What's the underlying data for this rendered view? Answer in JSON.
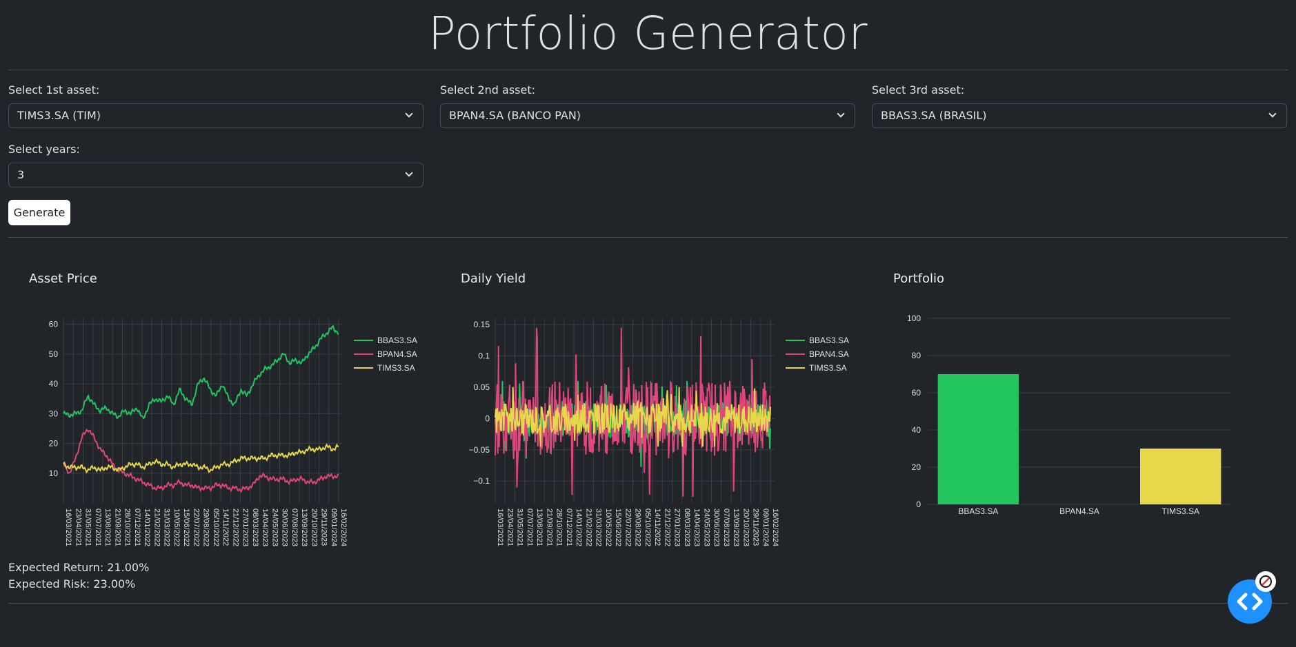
{
  "header": {
    "title": "Portfolio Generator"
  },
  "form": {
    "asset1": {
      "label": "Select 1st asset:",
      "value": "TIMS3.SA (TIM)"
    },
    "asset2": {
      "label": "Select 2nd asset:",
      "value": "BPAN4.SA (BANCO PAN)"
    },
    "asset3": {
      "label": "Select 3rd asset:",
      "value": "BBAS3.SA (BRASIL)"
    },
    "years": {
      "label": "Select years:",
      "value": "3"
    },
    "generate_label": "Generate"
  },
  "charts": {
    "price_title": "Asset Price",
    "yield_title": "Daily Yield",
    "portfolio_title": "Portfolio"
  },
  "results": {
    "expected_return": "Expected Return: 21.00%",
    "expected_risk": "Expected Risk: 23.00%"
  },
  "icons": {
    "fab": "code-icon",
    "badge": "block-icon"
  },
  "colors": {
    "BBAS3.SA": "#22c55e",
    "BPAN4.SA": "#e0457b",
    "TIMS3.SA": "#e6d84a",
    "fab": "#1e90ff"
  },
  "chart_data": [
    {
      "type": "line",
      "title": "Asset Price",
      "ylim": [
        0,
        62
      ],
      "yticks": [
        "10",
        "20",
        "30",
        "40",
        "50",
        "60"
      ],
      "ytick_values": [
        10,
        20,
        30,
        40,
        50,
        60
      ],
      "xticks": [
        "16/03/2021",
        "23/04/2021",
        "31/05/2021",
        "07/07/2021",
        "13/08/2021",
        "21/09/2021",
        "28/10/2021",
        "07/12/2021",
        "14/01/2022",
        "21/02/2022",
        "31/03/2022",
        "10/05/2022",
        "15/06/2022",
        "22/07/2022",
        "29/08/2022",
        "05/10/2022",
        "14/11/2022",
        "21/12/2022",
        "27/01/2023",
        "08/03/2023",
        "14/04/2023",
        "24/05/2023",
        "30/06/2023",
        "07/08/2023",
        "13/09/2023",
        "20/10/2023",
        "29/11/2023",
        "09/01/2024",
        "16/02/2024"
      ],
      "legend": [
        "BBAS3.SA",
        "BPAN4.SA",
        "TIMS3.SA"
      ],
      "series": [
        {
          "name": "BBAS3.SA",
          "values": [
            30,
            29.5,
            30,
            31,
            36,
            33,
            31,
            32,
            30,
            29,
            31,
            30,
            32,
            28,
            33,
            35,
            34,
            36,
            33,
            38,
            35,
            33,
            40,
            42,
            38,
            36,
            40,
            35,
            33,
            38,
            36,
            40,
            43,
            45,
            46,
            48,
            50,
            47,
            48,
            47,
            50,
            52,
            55,
            57,
            59,
            57
          ]
        },
        {
          "name": "BPAN4.SA",
          "values": [
            13,
            10,
            15,
            22,
            25,
            22,
            18,
            16,
            13,
            11,
            10,
            9,
            8,
            7,
            6,
            5,
            5,
            6,
            6,
            7,
            6,
            6,
            5,
            5,
            5,
            6,
            6,
            5,
            5,
            4.5,
            5,
            6,
            9,
            9,
            8,
            8,
            8,
            7,
            8,
            8,
            7,
            7,
            8,
            9,
            9,
            9
          ]
        },
        {
          "name": "TIMS3.SA",
          "values": [
            13,
            12,
            12,
            12,
            11,
            12,
            11,
            12,
            12,
            11,
            12,
            13,
            13,
            12,
            13,
            14,
            13,
            13,
            12,
            13,
            13,
            13,
            12,
            12,
            11,
            12,
            13,
            13,
            14,
            15,
            15,
            15,
            15,
            15,
            16,
            16,
            16,
            16,
            17,
            17,
            18,
            18,
            18,
            19,
            18,
            19
          ]
        }
      ]
    },
    {
      "type": "line",
      "title": "Daily Yield",
      "ylim": [
        -0.135,
        0.16
      ],
      "yticks": [
        "0.15",
        "0.1",
        "0.05",
        "0",
        "−0.05",
        "−0.1"
      ],
      "ytick_values": [
        0.15,
        0.1,
        0.05,
        0,
        -0.05,
        -0.1
      ],
      "xticks": [
        "16/03/2021",
        "23/04/2021",
        "31/05/2021",
        "07/07/2021",
        "13/08/2021",
        "21/09/2021",
        "28/10/2021",
        "07/12/2021",
        "14/01/2022",
        "21/02/2022",
        "31/03/2022",
        "10/05/2022",
        "15/06/2022",
        "22/07/2022",
        "29/08/2022",
        "05/10/2022",
        "14/11/2022",
        "21/12/2022",
        "27/01/2023",
        "08/03/2023",
        "14/04/2023",
        "24/05/2023",
        "30/06/2023",
        "07/08/2023",
        "13/09/2023",
        "20/10/2023",
        "29/11/2023",
        "09/01/2024",
        "16/02/2024"
      ],
      "legend": [
        "BBAS3.SA",
        "BPAN4.SA",
        "TIMS3.SA"
      ],
      "series": [
        {
          "name": "BBAS3.SA",
          "amplitude": 0.03,
          "min": -0.105,
          "max": 0.06
        },
        {
          "name": "BPAN4.SA",
          "amplitude": 0.06,
          "min": -0.125,
          "max": 0.145
        },
        {
          "name": "TIMS3.SA",
          "amplitude": 0.025,
          "min": -0.045,
          "max": 0.05
        }
      ]
    },
    {
      "type": "bar",
      "title": "Portfolio",
      "categories": [
        "BBAS3.SA",
        "BPAN4.SA",
        "TIMS3.SA"
      ],
      "values": [
        70,
        0,
        30
      ],
      "ylim": [
        0,
        100
      ],
      "yticks": [
        "0",
        "20",
        "40",
        "60",
        "80",
        "100"
      ],
      "ytick_values": [
        0,
        20,
        40,
        60,
        80,
        100
      ]
    }
  ]
}
